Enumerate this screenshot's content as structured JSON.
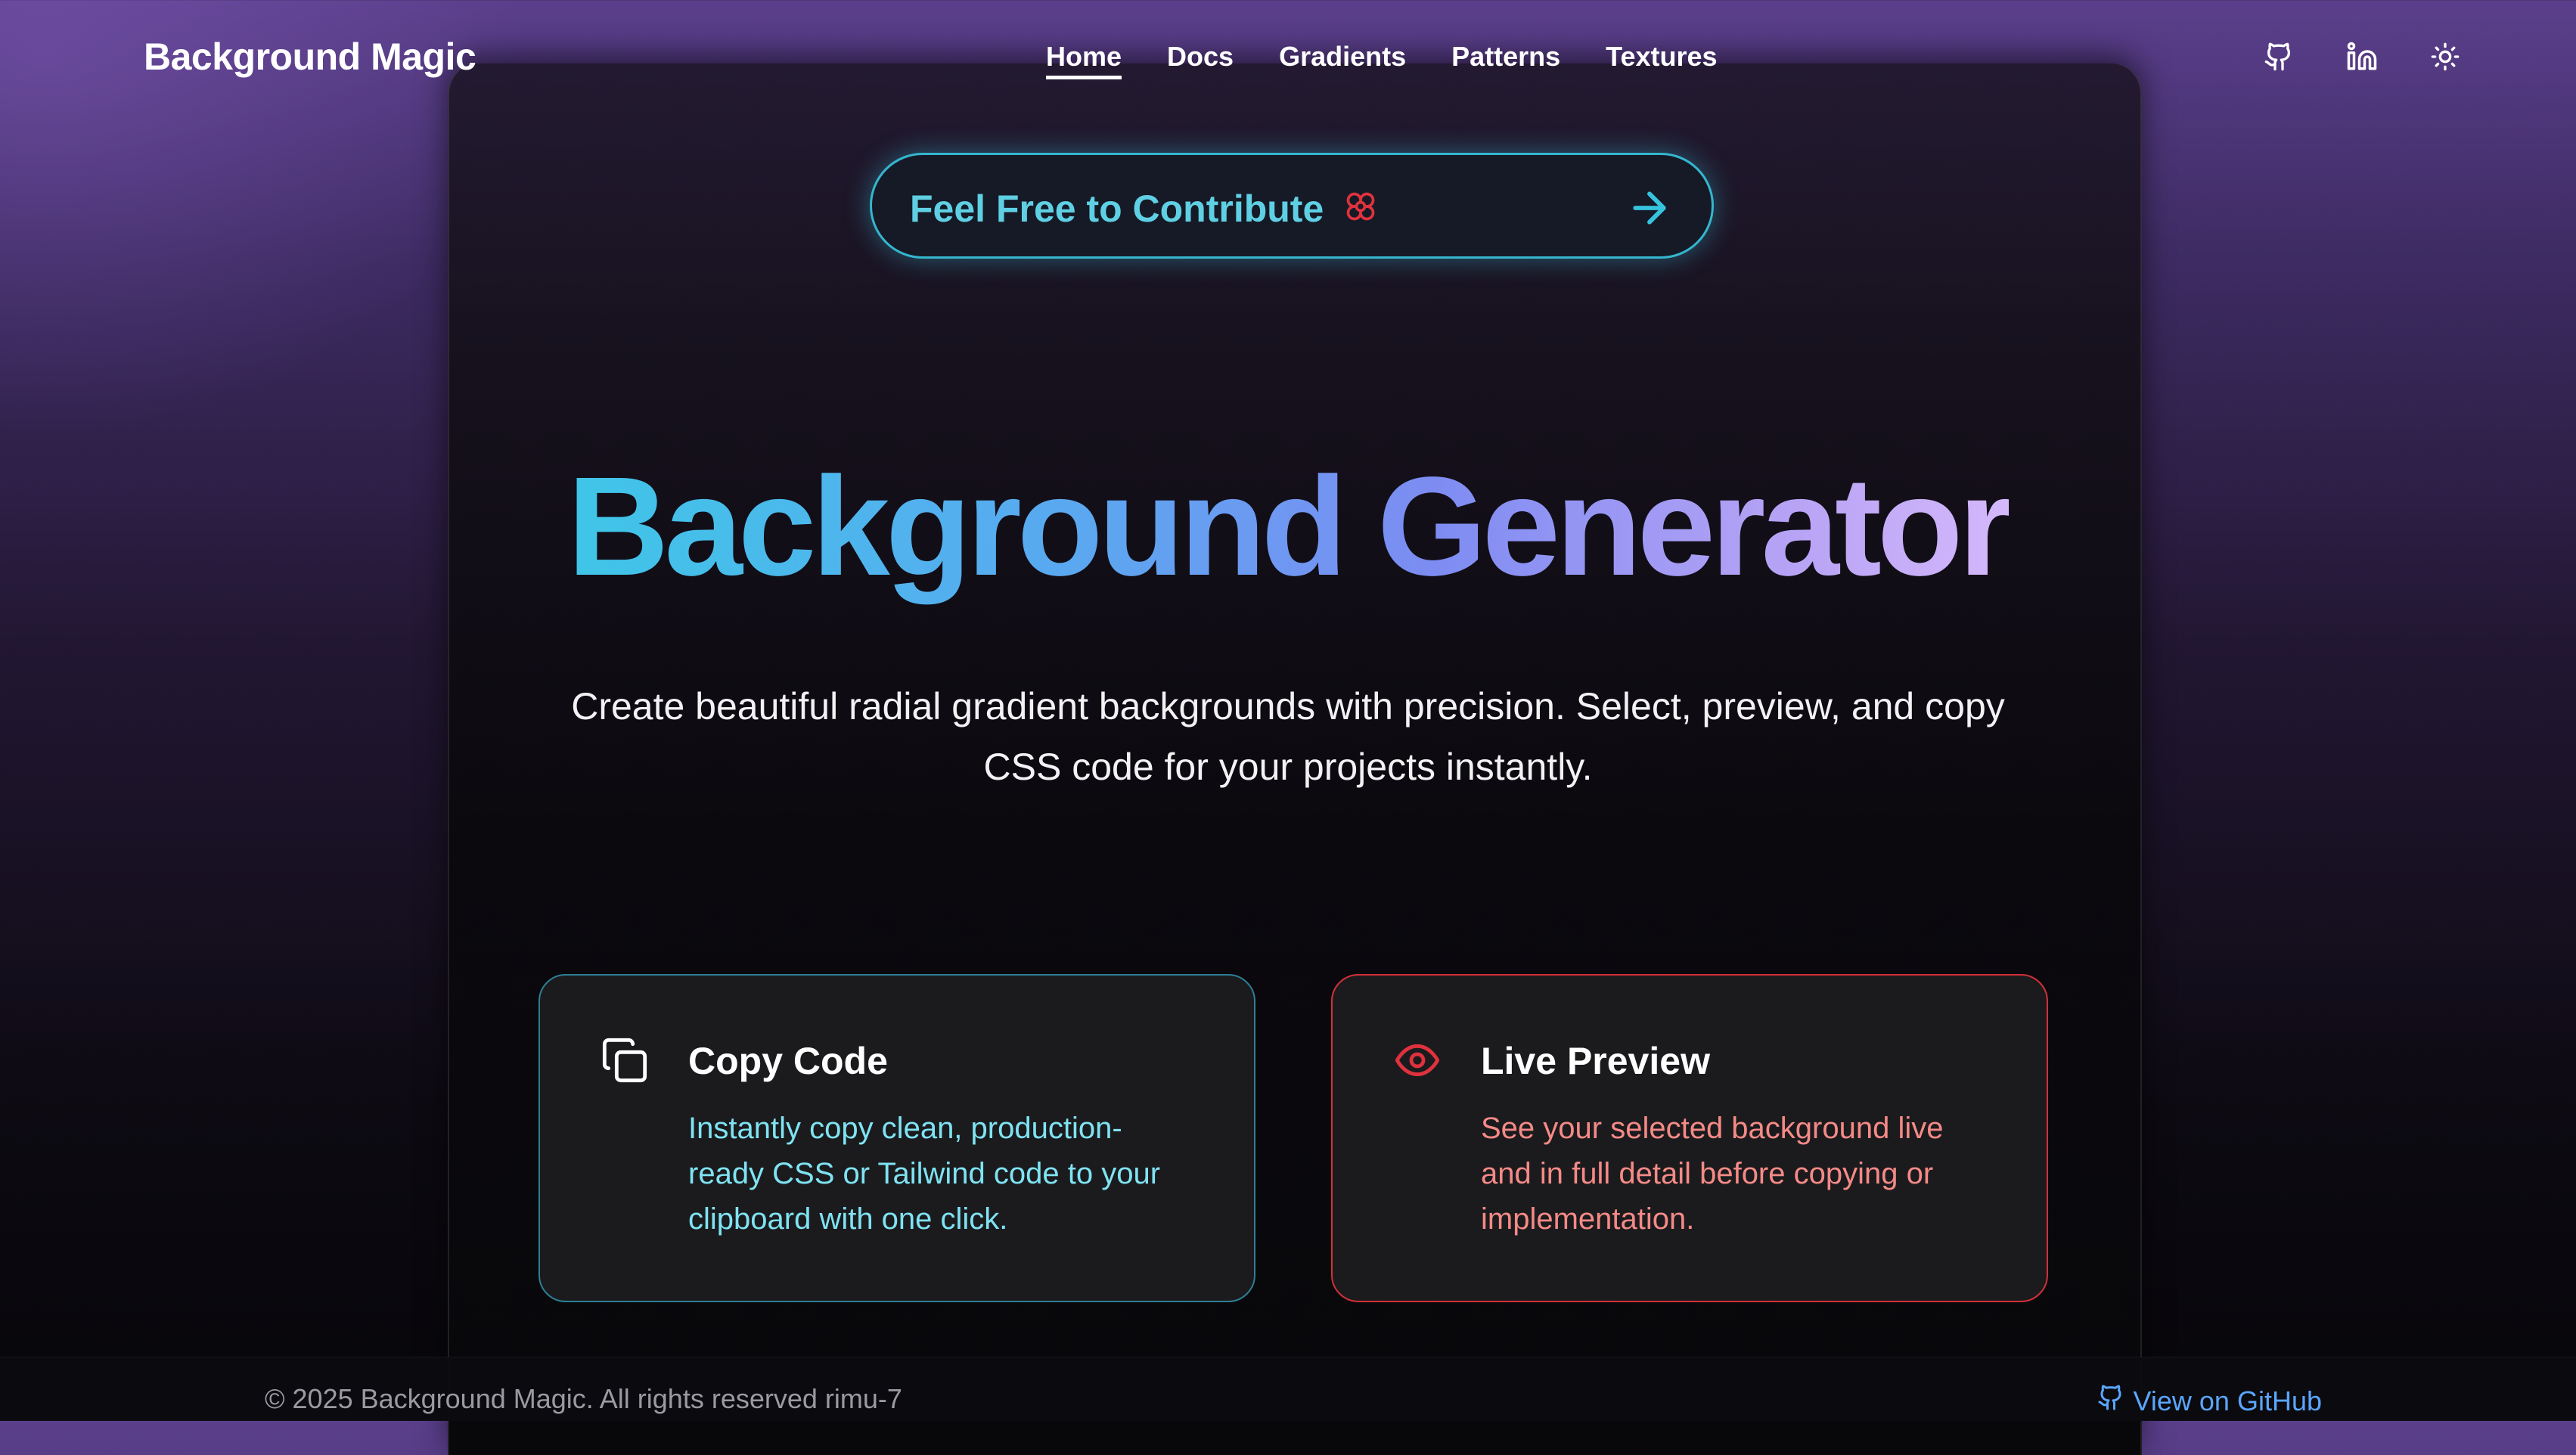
{
  "header": {
    "brand": "Background Magic",
    "nav": [
      {
        "label": "Home",
        "active": true
      },
      {
        "label": "Docs",
        "active": false
      },
      {
        "label": "Gradients",
        "active": false
      },
      {
        "label": "Patterns",
        "active": false
      },
      {
        "label": "Textures",
        "active": false
      }
    ],
    "icons": [
      "github-icon",
      "linkedin-icon",
      "sun-icon"
    ]
  },
  "contribute": {
    "label": "Feel Free to Contribute",
    "icons": [
      "flower-icon",
      "arrow-right-icon"
    ]
  },
  "hero": {
    "title": "Background Generator",
    "description": "Create beautiful radial gradient backgrounds with precision. Select, preview, and copy CSS code for your projects instantly."
  },
  "features": [
    {
      "icon": "copy-icon",
      "title": "Copy Code",
      "text": "Instantly copy clean, production-ready CSS or Tailwind code to your clipboard with one click."
    },
    {
      "icon": "eye-icon",
      "title": "Live Preview",
      "text": "See your selected background live and in full detail before copying or implementation."
    }
  ],
  "footer": {
    "copyright": "© 2025 Background Magic. All rights reserved rimu-7",
    "github_link": "View on GitHub",
    "github_icon": "github-icon"
  },
  "colors": {
    "accent_cyan": "#35b6cf",
    "accent_red": "#d13038",
    "link_blue": "#5aa6ff"
  }
}
